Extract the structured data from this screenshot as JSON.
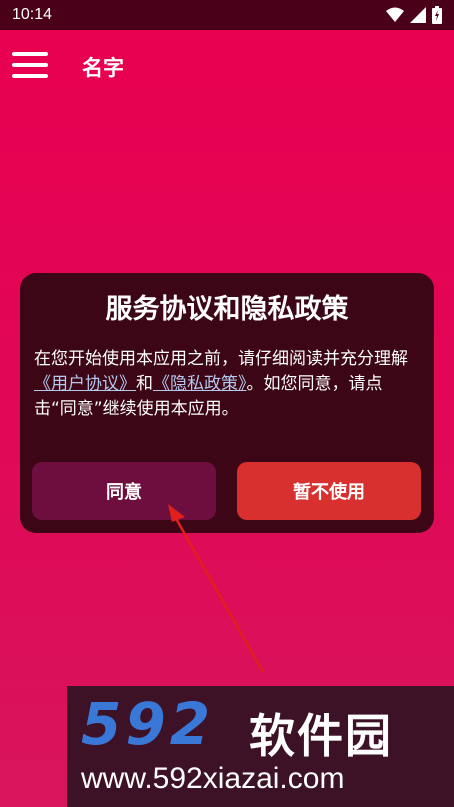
{
  "status_bar": {
    "time": "10:14"
  },
  "app_bar": {
    "title": "名字"
  },
  "dialog": {
    "title": "服务协议和隐私政策",
    "body_part1": "在您开始使用本应用之前，请仔细阅读并充分理解",
    "link_user_agreement": "《用户协议》",
    "body_and": "和",
    "link_privacy_policy": "《隐私政策》",
    "body_part2": "。如您同意，请点击“同意”继续使用本应用。",
    "agree_label": "同意",
    "decline_label": "暂不使用"
  },
  "watermark": {
    "logo": "592",
    "brand": "软件园",
    "url": "www.592xiazai.com"
  },
  "colors": {
    "background": "#e8004f",
    "status_bar": "#4a0018",
    "dialog": "#3c0616",
    "agree_button": "#6e0e3e",
    "decline_button": "#d8302f",
    "annotation_arrow": "#e0201c"
  },
  "icons": [
    "wifi-icon",
    "signal-icon",
    "battery-icon",
    "menu-icon"
  ]
}
